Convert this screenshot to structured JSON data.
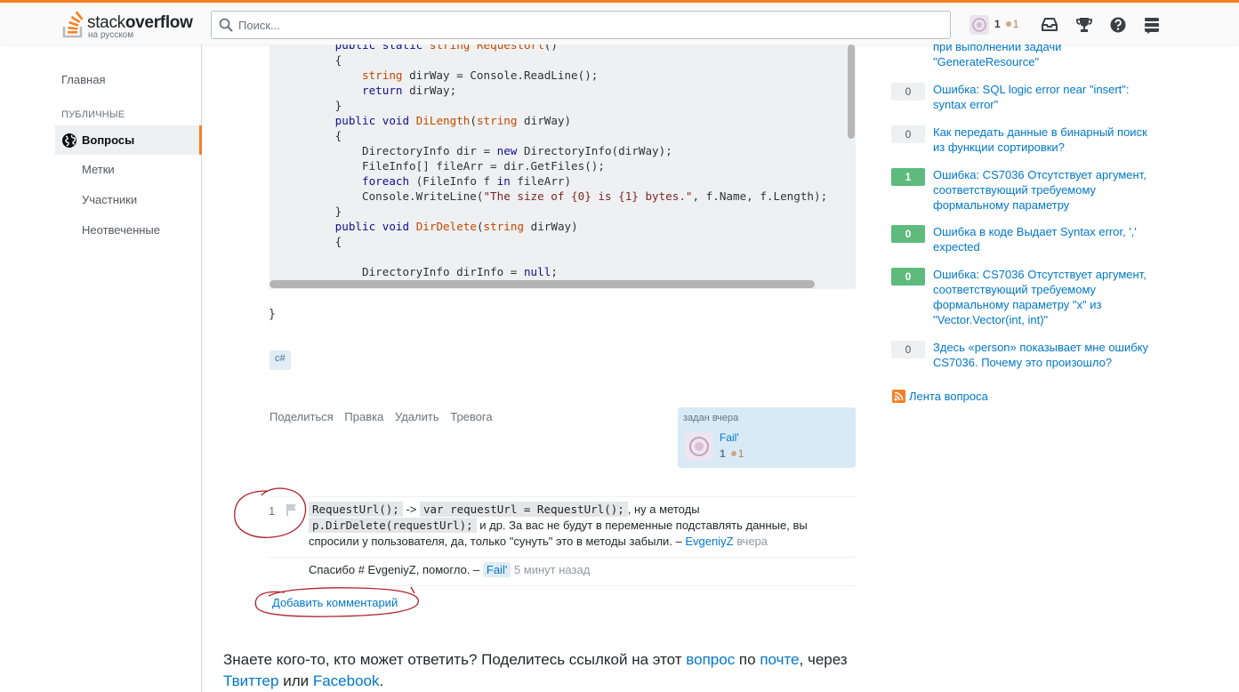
{
  "header": {
    "brand_prefix": "stack",
    "brand_bold": "overflow",
    "brand_sub": "на русском",
    "search_placeholder": "Поиск...",
    "reputation": "1",
    "bronze_count": "1"
  },
  "sidebar": {
    "home": "Главная",
    "section_public": "ПУБЛИЧНЫЕ",
    "questions": "Вопросы",
    "tags": "Метки",
    "users": "Участники",
    "unanswered": "Неотвеченные"
  },
  "post": {
    "closing_brace": "}",
    "tag": "c#",
    "menu": {
      "share": "Поделиться",
      "edit": "Правка",
      "delete": "Удалить",
      "flag": "Тревога"
    },
    "asked_label": "задан вчера",
    "author": "Fail'",
    "author_rep": "1",
    "author_bronze": "1"
  },
  "comments": [
    {
      "score": "1",
      "code1": "RequestUrl();",
      "arrow": " -> ",
      "code2": "var requestUrl = RequestUrl();",
      "text1": ", ну а методы ",
      "code3": "p.DirDelete(requestUrl);",
      "text2": " и др. За вас не будут в переменные подставлять данные, вы спросили у пользователя, да, только \"сунуть\" это в методы забыли. – ",
      "user": "EvgeniyZ",
      "date": "вчера"
    },
    {
      "text": "Спасибо # EvgeniyZ, помогло. – ",
      "user": "Fail'",
      "date": "5 минут назад"
    }
  ],
  "add_comment": "Добавить комментарий",
  "share_prompt": {
    "t1": "Знаете кого-то, кто может ответить? Поделитесь ссылкой на этот ",
    "link1": "вопрос",
    "t2": " по ",
    "link2": "почте",
    "t3": ", через ",
    "link3": "Твиттер",
    "t4": " или ",
    "link4": "Facebook",
    "t5": "."
  },
  "related": {
    "partial_title": "при выполнении задачи \"GenerateResource\"",
    "items": [
      {
        "score": "0",
        "accepted": false,
        "title": "Ошибка: SQL logic error near \"insert\": syntax error\""
      },
      {
        "score": "0",
        "accepted": false,
        "title": "Как передать данные в бинарный поиск из функции сортировки?"
      },
      {
        "score": "1",
        "accepted": true,
        "title": "Ошибка: CS7036 Отсутствует аргумент, соответствующий требуемому формальному параметру"
      },
      {
        "score": "0",
        "accepted": true,
        "title": "Ошибка в коде Выдает Syntax error, ',' expected"
      },
      {
        "score": "0",
        "accepted": true,
        "title": "Ошибка: CS7036 Отсутствует аргумент, соответствующий требуемому формальному параметру \"x\" из \"Vector.Vector(int, int)\""
      },
      {
        "score": "0",
        "accepted": false,
        "title": "Здесь «person» показывает мне ошибку CS7036. Почему это произошло?"
      }
    ],
    "feed": "Лента вопроса"
  },
  "colors": {
    "accent": "#f48024",
    "link": "#0077cc",
    "accepted": "#5eba7d",
    "annotation": "#b0202a"
  }
}
